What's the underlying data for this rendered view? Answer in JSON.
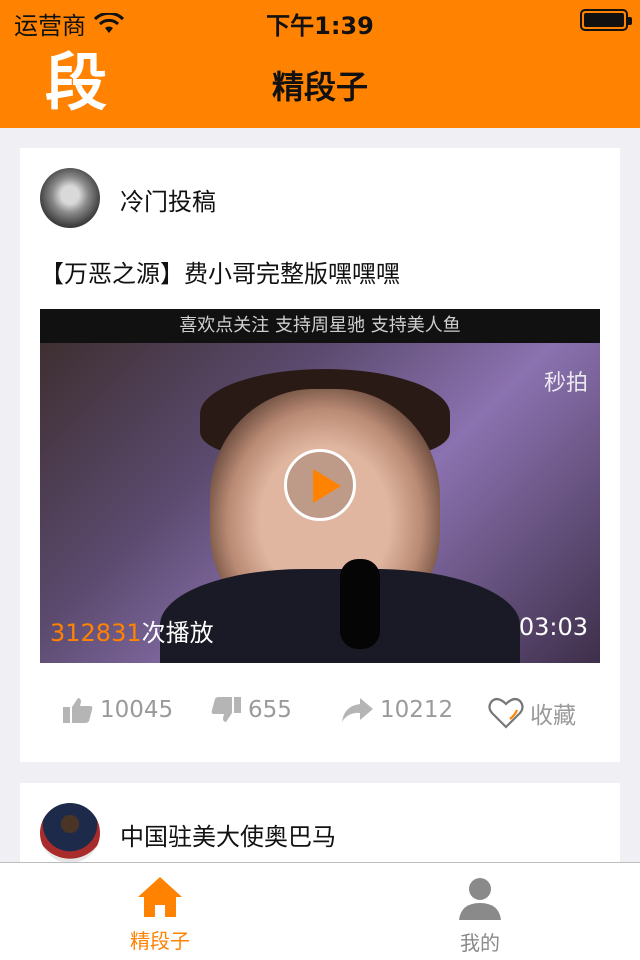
{
  "status_bar": {
    "carrier": "运营商",
    "time": "下午1:39"
  },
  "nav": {
    "logo_text": "段",
    "title": "精段子"
  },
  "posts": [
    {
      "author": "冷门投稿",
      "text": "【万恶之源】费小哥完整版嘿嘿嘿",
      "video": {
        "caption": "喜欢点关注   支持周星驰   支持美人鱼",
        "watermark": "秒拍",
        "play_count": "312831",
        "play_suffix": "次播放",
        "duration": "03:03"
      },
      "actions": {
        "likes": "10045",
        "dislikes": "655",
        "shares": "10212",
        "collect_label": "收藏"
      }
    },
    {
      "author": "中国驻美大使奥巴马"
    }
  ],
  "tabbar": {
    "home_label": "精段子",
    "mine_label": "我的"
  },
  "colors": {
    "accent": "#FF8200",
    "background": "#EFEFF4"
  },
  "icons": [
    "wifi-icon",
    "battery-icon",
    "thumbs-up-icon",
    "thumbs-down-icon",
    "share-icon",
    "heart-icon",
    "home-icon",
    "user-icon",
    "play-icon"
  ]
}
